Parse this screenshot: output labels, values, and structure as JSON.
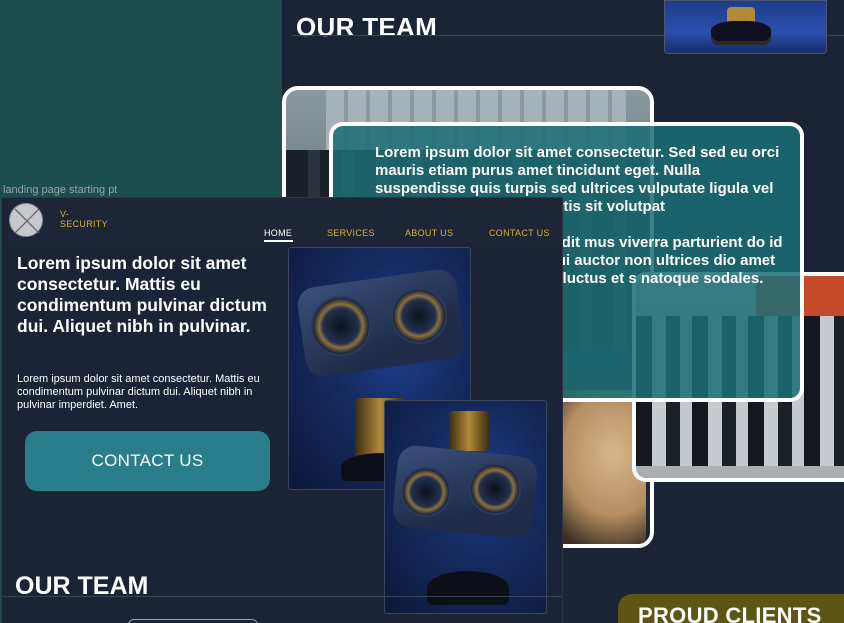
{
  "canvas": {
    "frame_label": "landing page starting pt",
    "top_section_heading": "OUR TEAM",
    "team_card_paragraph_1": "Lorem ipsum dolor sit amet consectetur. Sed sed eu orci mauris etiam purus amet tincidunt eget. Nulla suspendisse quis turpis sed ultrices vulputate ligula vel velit. Purus vel t. Odio mattis sit volutpat",
    "team_card_paragraph_2": "or faucibus neque odio andit mus viverra parturient do id scelerisque vel luctus c dui auctor non ultrices dio amet integer dui. im. Nibh amet luctus et s natoque sodales.",
    "proud_clients_heading": "PROUD CLIENTS"
  },
  "frame": {
    "brand": {
      "line1": "V-",
      "line2": "SECURITY"
    },
    "nav": {
      "home": "HOME",
      "services": "SERVICES",
      "about": "ABOUT US",
      "contact": "CONTACT US"
    },
    "hero": {
      "title": "Lorem ipsum dolor sit amet consectetur. Mattis eu condimentum pulvinar dictum dui. Aliquet nibh in pulvinar.",
      "subtitle": "Lorem ipsum dolor sit amet consectetur. Mattis eu condimentum pulvinar dictum dui. Aliquet nibh in pulvinar imperdiet. Amet.",
      "cta": "CONTACT US"
    },
    "team_heading": "OUR TEAM"
  },
  "colors": {
    "teal_panel": "#1d4d4c",
    "dark_bg": "#1b2336",
    "accent_gold": "#d8b22c",
    "cta_teal": "#2a7d8a",
    "overlay_teal": "#1c6e76",
    "proud_bg": "#5e5414"
  }
}
